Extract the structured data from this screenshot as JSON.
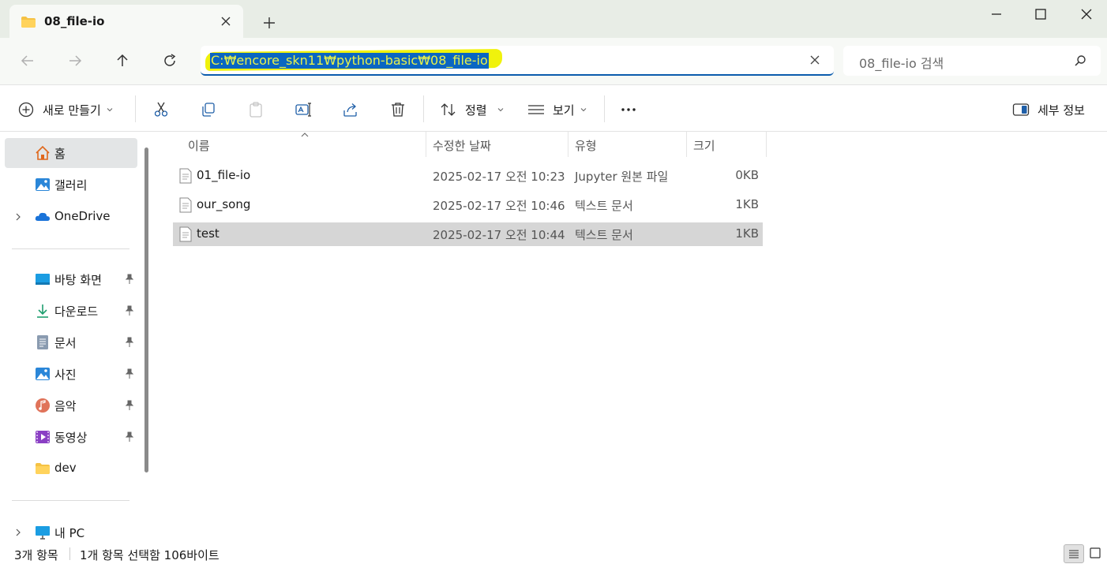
{
  "tab": {
    "title": "08_file-io",
    "new_tab": "+"
  },
  "window": {
    "minimize": "minimize",
    "maximize": "maximize",
    "close": "close"
  },
  "address": {
    "path": "C:₩encore_skn11₩python-basic₩08_file-io",
    "highlight_color": "#f0f20c",
    "selection_color": "#0a66c2"
  },
  "search": {
    "placeholder": "08_file-io 검색"
  },
  "toolbar": {
    "new_label": "새로 만들기",
    "sort_label": "정렬",
    "view_label": "보기",
    "more_label": "···",
    "details_label": "세부 정보"
  },
  "sidebar": {
    "home": "홈",
    "gallery": "갤러리",
    "onedrive": "OneDrive",
    "quick_access": [
      {
        "label": "바탕 화면",
        "icon": "desktop-icon"
      },
      {
        "label": "다운로드",
        "icon": "download-icon"
      },
      {
        "label": "문서",
        "icon": "document-icon"
      },
      {
        "label": "사진",
        "icon": "pictures-icon"
      },
      {
        "label": "음악",
        "icon": "music-icon"
      },
      {
        "label": "동영상",
        "icon": "video-icon"
      }
    ],
    "dev": "dev",
    "this_pc": "내 PC"
  },
  "columns": {
    "name": "이름",
    "modified": "수정한 날짜",
    "type": "유형",
    "size": "크기"
  },
  "files": [
    {
      "name": "01_file-io",
      "modified": "2025-02-17 오전 10:23",
      "type": "Jupyter 원본 파일",
      "size": "0KB"
    },
    {
      "name": "our_song",
      "modified": "2025-02-17 오전 10:46",
      "type": "텍스트 문서",
      "size": "1KB"
    },
    {
      "name": "test",
      "modified": "2025-02-17 오전 10:44",
      "type": "텍스트 문서",
      "size": "1KB",
      "selected": true
    }
  ],
  "status": {
    "count": "3개 항목",
    "selection": "1개 항목 선택함 106바이트"
  },
  "colors": {
    "accent": "#0b5cad",
    "folder": "#f5c244",
    "titlebar_bg": "#e8ede6",
    "selected_row": "#d6d6d6"
  }
}
